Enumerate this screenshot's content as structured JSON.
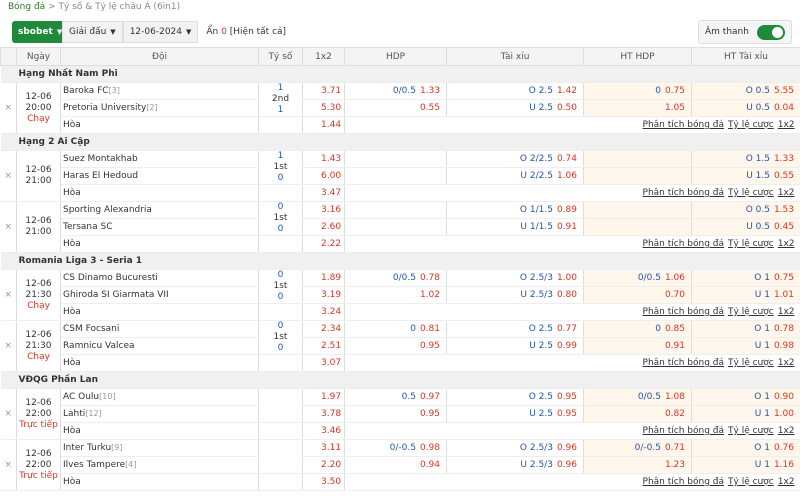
{
  "breadcrumb": {
    "home": "Bóng đá",
    "sep": ">",
    "current": "Tỷ số & Tỷ lệ châu Á  (6in1)"
  },
  "toolbar": {
    "bookmaker": "sbobet",
    "league": "Giải đấu",
    "date": "12-06-2024",
    "hidden_label": "Ẩn",
    "hidden_count": "0",
    "show_all": "[Hiện tất cả]",
    "sound_label": "Âm thanh"
  },
  "columns": {
    "date": "Ngày",
    "team": "Đội",
    "score": "Tỷ số",
    "x12": "1x2",
    "hdp": "HDP",
    "tx": "Tài xỉu",
    "ht_hdp": "HT HDP",
    "ht_tx": "HT Tài xỉu"
  },
  "links": {
    "analysis": "Phân tích bóng đá",
    "odds": "Tỷ lệ cược",
    "x12": "1x2"
  },
  "leagues": [
    {
      "name": "Hạng Nhất Nam Phi",
      "matches": [
        {
          "date": "12-06",
          "time": "20:00",
          "status": "Chạy",
          "home": "Baroka FC",
          "home_rank": "[3]",
          "away": "Pretoria University",
          "away_rank": "[2]",
          "s1": "1",
          "period": "2nd",
          "s2": "1",
          "o1": "3.71",
          "o2": "5.30",
          "ox": "1.44",
          "hdp1l": "0/0.5",
          "hdp1o": "1.33",
          "hdp2l": "",
          "hdp2o": "0.55",
          "tx1l": "O 2.5",
          "tx1o": "1.42",
          "tx2l": "U 2.5",
          "tx2o": "0.50",
          "hh1l": "0",
          "hh1o": "0.75",
          "hh2l": "",
          "hh2o": "1.05",
          "ht1l": "O 0.5",
          "ht1o": "5.55",
          "ht2l": "U 0.5",
          "ht2o": "0.04"
        }
      ]
    },
    {
      "name": "Hạng 2 Ai Cập",
      "matches": [
        {
          "date": "12-06",
          "time": "21:00",
          "status": "",
          "home": "Suez Montakhab",
          "home_rank": "",
          "away": "Haras El Hedoud",
          "away_rank": "",
          "s1": "1",
          "period": "1st",
          "s2": "0",
          "o1": "1.43",
          "o2": "6.00",
          "ox": "3.47",
          "hdp1l": "",
          "hdp1o": "",
          "hdp2l": "",
          "hdp2o": "",
          "tx1l": "O 2/2.5",
          "tx1o": "0.74",
          "tx2l": "U 2/2.5",
          "tx2o": "1.06",
          "hh1l": "",
          "hh1o": "",
          "hh2l": "",
          "hh2o": "",
          "ht1l": "O 1.5",
          "ht1o": "1.33",
          "ht2l": "U 1.5",
          "ht2o": "0.55"
        },
        {
          "date": "12-06",
          "time": "21:00",
          "status": "",
          "home": "Sporting Alexandria",
          "home_rank": "",
          "away": "Tersana SC",
          "away_rank": "",
          "s1": "0",
          "period": "1st",
          "s2": "0",
          "o1": "3.16",
          "o2": "2.60",
          "ox": "2.22",
          "hdp1l": "",
          "hdp1o": "",
          "hdp2l": "",
          "hdp2o": "",
          "tx1l": "O 1/1.5",
          "tx1o": "0.89",
          "tx2l": "U 1/1.5",
          "tx2o": "0.91",
          "hh1l": "",
          "hh1o": "",
          "hh2l": "",
          "hh2o": "",
          "ht1l": "O 0.5",
          "ht1o": "1.53",
          "ht2l": "U 0.5",
          "ht2o": "0.45"
        }
      ]
    },
    {
      "name": "Romania Liga 3 - Seria 1",
      "matches": [
        {
          "date": "12-06",
          "time": "21:30",
          "status": "Chạy",
          "home": "CS Dinamo Bucuresti",
          "home_rank": "",
          "away": "Ghiroda SI Giarmata VII",
          "away_rank": "",
          "s1": "0",
          "period": "1st",
          "s2": "0",
          "o1": "1.89",
          "o2": "3.19",
          "ox": "3.24",
          "hdp1l": "0/0.5",
          "hdp1o": "0.78",
          "hdp2l": "",
          "hdp2o": "1.02",
          "tx1l": "O 2.5/3",
          "tx1o": "1.00",
          "tx2l": "U 2.5/3",
          "tx2o": "0.80",
          "hh1l": "0/0.5",
          "hh1o": "1.06",
          "hh2l": "",
          "hh2o": "0.70",
          "ht1l": "O 1",
          "ht1o": "0.75",
          "ht2l": "U 1",
          "ht2o": "1.01"
        },
        {
          "date": "12-06",
          "time": "21:30",
          "status": "Chạy",
          "home": "CSM Focsani",
          "home_rank": "",
          "away": "Ramnicu Valcea",
          "away_rank": "",
          "s1": "0",
          "period": "1st",
          "s2": "0",
          "o1": "2.34",
          "o2": "2.51",
          "ox": "3.07",
          "hdp1l": "0",
          "hdp1o": "0.81",
          "hdp2l": "",
          "hdp2o": "0.95",
          "tx1l": "O 2.5",
          "tx1o": "0.77",
          "tx2l": "U 2.5",
          "tx2o": "0.99",
          "hh1l": "0",
          "hh1o": "0.85",
          "hh2l": "",
          "hh2o": "0.91",
          "ht1l": "O 1",
          "ht1o": "0.78",
          "ht2l": "U 1",
          "ht2o": "0.98"
        }
      ]
    },
    {
      "name": "VĐQG Phần Lan",
      "matches": [
        {
          "date": "12-06",
          "time": "22:00",
          "status": "Trực tiếp",
          "home": "AC Oulu",
          "home_rank": "[10]",
          "away": "Lahti",
          "away_rank": "[12]",
          "s1": "",
          "period": "",
          "s2": "",
          "o1": "1.97",
          "o2": "3.78",
          "ox": "3.46",
          "hdp1l": "0.5",
          "hdp1o": "0.97",
          "hdp2l": "",
          "hdp2o": "0.95",
          "tx1l": "O 2.5",
          "tx1o": "0.95",
          "tx2l": "U 2.5",
          "tx2o": "0.95",
          "hh1l": "0/0.5",
          "hh1o": "1.08",
          "hh2l": "",
          "hh2o": "0.82",
          "ht1l": "O 1",
          "ht1o": "0.90",
          "ht2l": "U 1",
          "ht2o": "1.00"
        },
        {
          "date": "12-06",
          "time": "22:00",
          "status": "Trực tiếp",
          "home": "Inter Turku",
          "home_rank": "[9]",
          "away": "Ilves Tampere",
          "away_rank": "[4]",
          "s1": "",
          "period": "",
          "s2": "",
          "o1": "3.11",
          "o2": "2.20",
          "ox": "3.50",
          "hdp1l": "0/-0.5",
          "hdp1o": "0.98",
          "hdp2l": "",
          "hdp2o": "0.94",
          "tx1l": "O 2.5/3",
          "tx1o": "0.96",
          "tx2l": "U 2.5/3",
          "tx2o": "0.96",
          "hh1l": "0/-0.5",
          "hh1o": "0.71",
          "hh2l": "",
          "hh2o": "1.23",
          "ht1l": "O 1",
          "ht1o": "0.76",
          "ht2l": "U 1",
          "ht2o": "1.16"
        }
      ]
    }
  ]
}
